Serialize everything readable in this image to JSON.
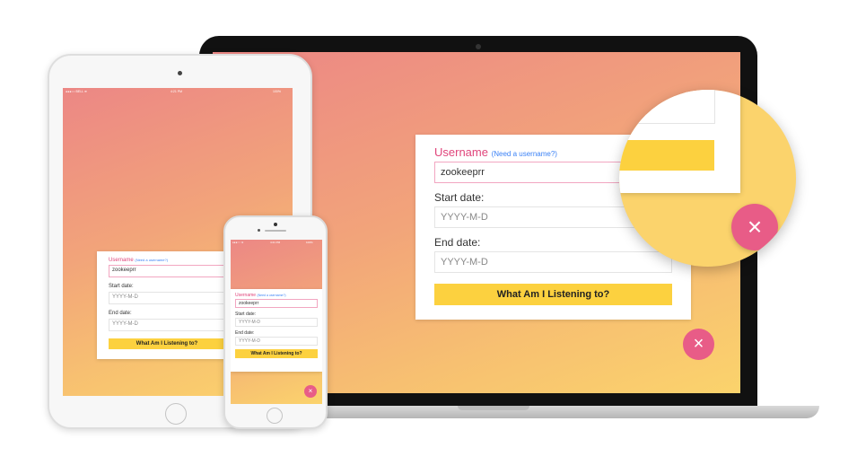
{
  "form": {
    "username_label": "Username",
    "username_hint": "(Need a username?)",
    "username_value": "zookeeprr",
    "start_label": "Start date:",
    "start_placeholder": "YYYY-M-D",
    "end_label": "End date:",
    "end_placeholder": "YYYY-M-D",
    "submit_label": "What Am I Listening to?",
    "close_glyph": "×"
  },
  "tablet_status": {
    "carrier": "●●●○○ BELL ≋",
    "time": "4:21 PM",
    "battery": "100%"
  },
  "phone_status": {
    "carrier": "●●●○○ ≋",
    "time": "4:21 PM",
    "battery": "100%"
  },
  "colors": {
    "accent_pink": "#e0457b",
    "link_blue": "#3b82f6",
    "button_yellow": "#fcd13f",
    "fab_pink": "#e85c87",
    "gradient_top": "#ec8785",
    "gradient_bottom": "#fbd36c"
  }
}
